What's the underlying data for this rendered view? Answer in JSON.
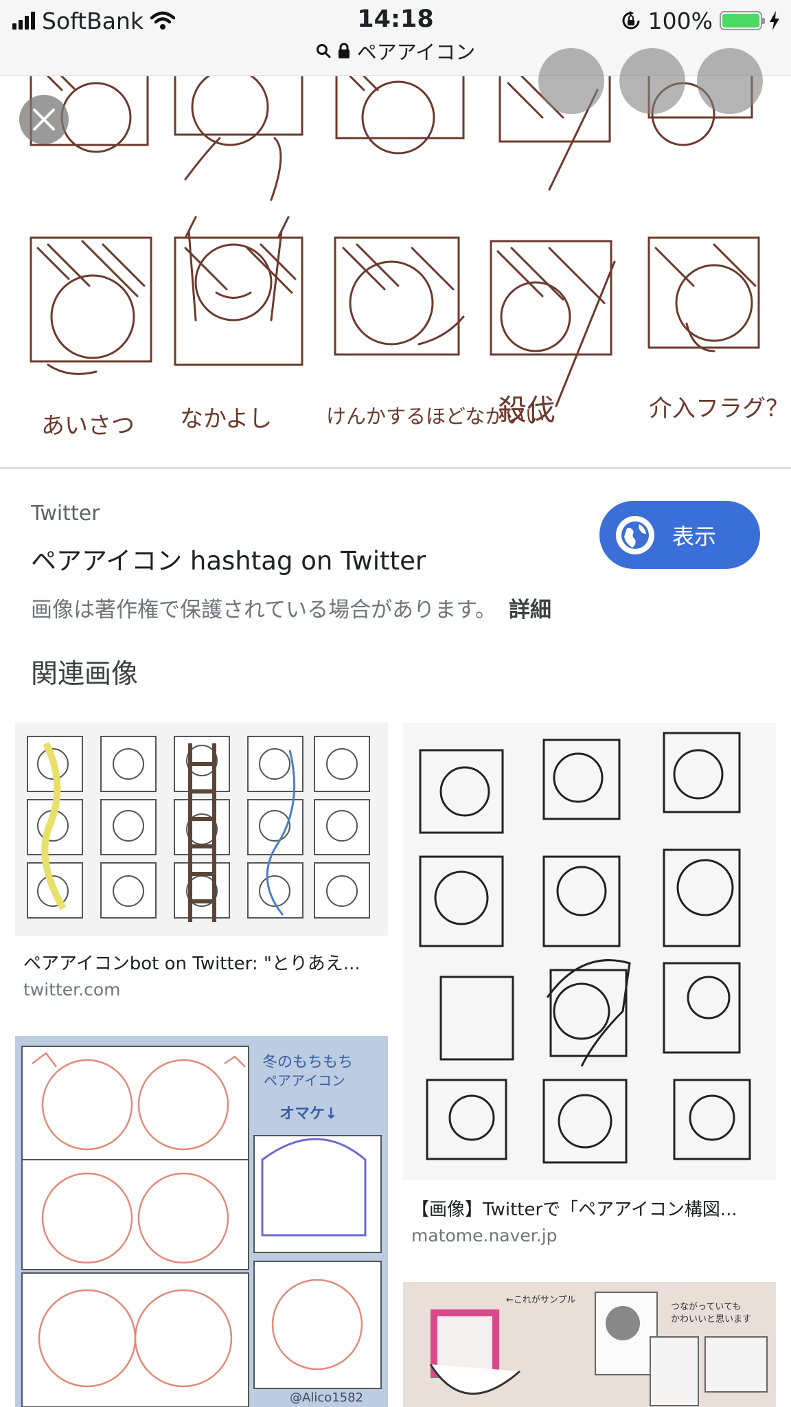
{
  "status_bar": {
    "carrier": "SoftBank",
    "time": "14:18",
    "battery": "100%",
    "battery_level": 1.0
  },
  "url_bar": {
    "query": "ペアアイコン"
  },
  "hero": {
    "captions": [
      "あいさつ",
      "なかよし",
      "けんかするほどなかいい",
      "殺伐",
      "介入フラグ？"
    ]
  },
  "source": {
    "site": "Twitter",
    "title": "ペアアイコン hashtag on Twitter",
    "visit_label": "表示",
    "copyright_notice": "画像は著作権で保護されている場合があります。",
    "more_label": "詳細"
  },
  "related": {
    "title": "関連画像",
    "items": [
      {
        "caption": "ペアアイコンbot on Twitter: \"とりあえ...",
        "domain": "twitter.com"
      },
      {
        "caption": "【画像】Twitterで「ペアアイコン構図...",
        "domain": "matome.naver.jp"
      },
      {
        "overlay_text": [
          "冬のもちもち",
          "ペアアイコン",
          "オマケ↓",
          "@Alico1582"
        ]
      },
      {
        "overlay_text": [
          "←これがサンプル",
          "つながっていても",
          "かわいいと思います"
        ]
      }
    ]
  },
  "icons": {
    "signal": "signal-bars-icon",
    "wifi": "wifi-icon",
    "orientation_lock": "orientation-lock-icon",
    "charging": "charging-bolt-icon",
    "search": "search-icon",
    "lock": "lock-icon",
    "close": "close-icon",
    "globe": "globe-icon"
  },
  "colors": {
    "accent": "#3b6fd8",
    "battery": "#4cd964",
    "sketch_line": "#6b3a2c"
  }
}
